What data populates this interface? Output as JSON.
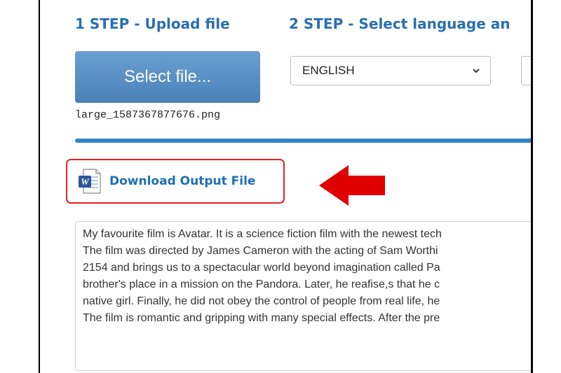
{
  "steps": {
    "step1_heading": "1 STEP - Upload file",
    "step2_heading": "2 STEP - Select language an"
  },
  "upload": {
    "button_label": "Select file...",
    "filename": "large_1587367877676.png"
  },
  "language": {
    "selected": "ENGLISH"
  },
  "download": {
    "label": "Download Output File",
    "icon": "word-document-icon"
  },
  "annotation": {
    "arrow_color": "#e00000",
    "highlight_color": "#e02222"
  },
  "output": {
    "lines": [
      "My favourite film is Avatar. It is a science fiction film with the newest tech",
      "The film was directed by James Cameron with the acting of Sam Worthi",
      "2154 and brings us to a spectacular world beyond imagination called Pa",
      "brother's place in a mission on the Pandora. Later, he reafise,s that he c",
      "native girl. Finally, he did not obey the control of people from real life, he",
      "The film is romantic and gripping with many special effects. After the pre"
    ]
  },
  "colors": {
    "accent_blue": "#2a6fb0",
    "button_blue": "#4a81b8",
    "divider_blue": "#2f86c9"
  }
}
